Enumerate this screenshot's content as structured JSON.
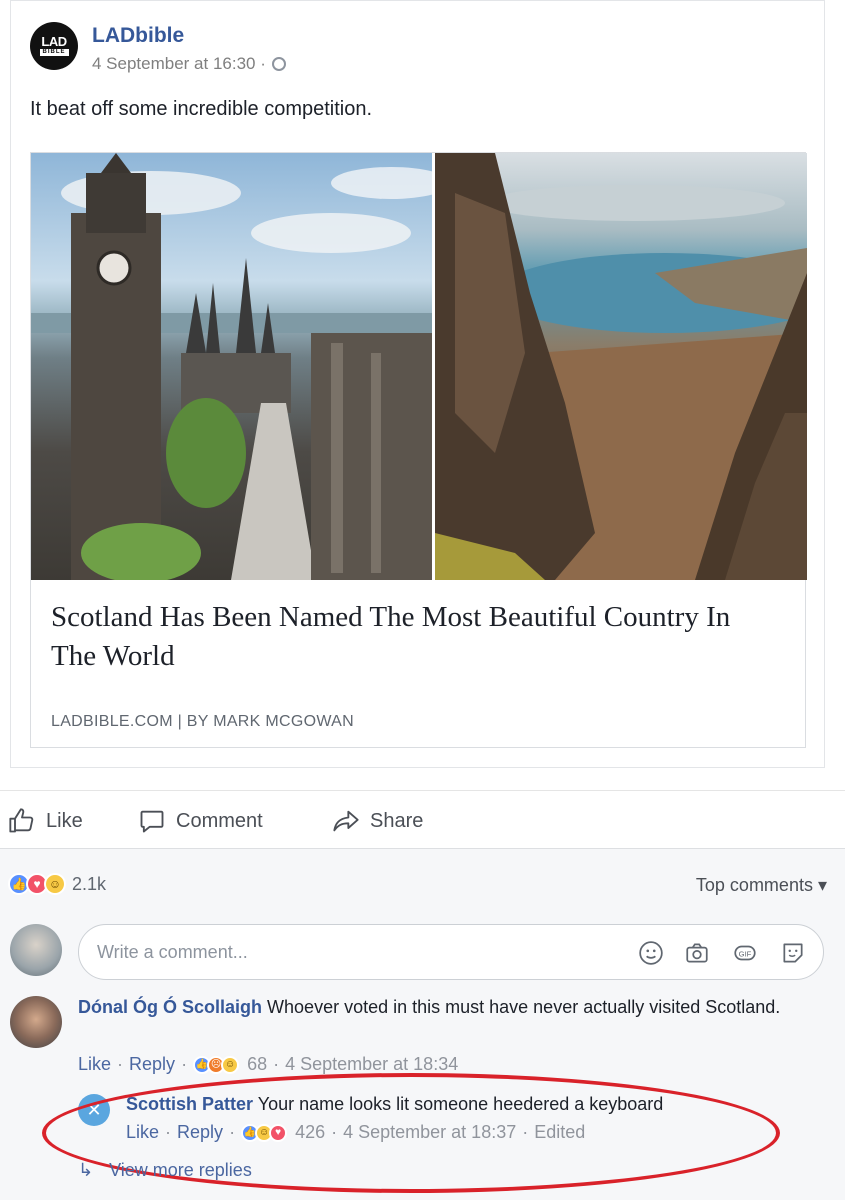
{
  "post": {
    "page_name": "LADbible",
    "avatar_top": "LAD",
    "avatar_bottom": "BIBLE",
    "timestamp": "4 September at 16:30 ·",
    "text": "It beat off some incredible competition.",
    "link": {
      "title": "Scotland Has Been Named The Most Beautiful Country In The World",
      "source": "LADBIBLE.COM | BY MARK MCGOWAN"
    }
  },
  "actions": {
    "like": "Like",
    "comment": "Comment",
    "share": "Share"
  },
  "stats": {
    "reaction_count": "2.1k",
    "sort_label": "Top comments ▾"
  },
  "comment_box": {
    "placeholder": "Write a comment..."
  },
  "comments": [
    {
      "author": "Dónal Óg Ó Scollaigh",
      "text": "Whoever voted in this must have never actually visited Scotland.",
      "like": "Like",
      "reply": "Reply",
      "count": "68",
      "time": "4 September at 18:34"
    },
    {
      "author": "Scottish Patter",
      "text": "Your name looks lit someone heedered a keyboard",
      "like": "Like",
      "reply": "Reply",
      "count": "426",
      "time": "4 September at 18:37",
      "edited": "Edited"
    }
  ],
  "view_more": "View more replies",
  "colors": {
    "link_blue": "#365899",
    "like_blue": "#5890ff",
    "love_red": "#f25268",
    "haha_yellow": "#f7c945",
    "annotation_red": "#d9222a"
  }
}
